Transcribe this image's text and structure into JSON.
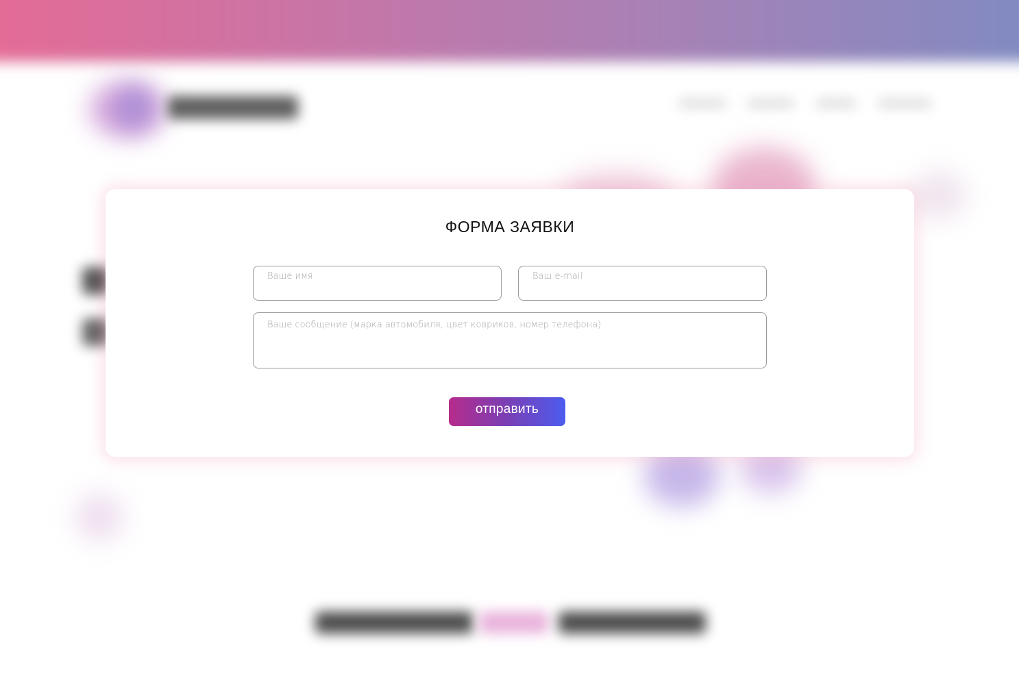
{
  "modal": {
    "title": "ФОРМА ЗАЯВКИ",
    "fields": {
      "name_placeholder": "Ваше имя",
      "name_value": "",
      "email_placeholder": "Ваш e-mail",
      "email_value": "",
      "message_placeholder": "Ваше сообщение (марка автомобиля, цвет ковриков, номер телефона)",
      "message_value": ""
    },
    "submit_label": "отправить"
  },
  "colors": {
    "header_gradient": [
      "#e56b95",
      "#c576a8",
      "#a682b6",
      "#7f8bc2"
    ],
    "button_gradient": [
      "#b62c8b",
      "#7a3fb5",
      "#4c5cef"
    ],
    "modal_shadow": "#f08caa"
  }
}
